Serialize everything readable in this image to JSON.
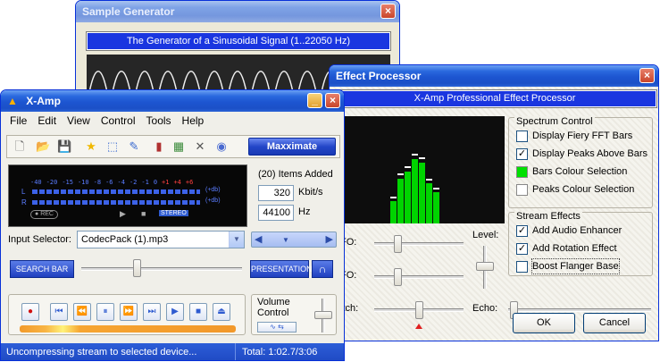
{
  "generator": {
    "title": "Sample Generator",
    "banner": "The Generator of a Sinusoidal Signal (1..22050 Hz)"
  },
  "fx": {
    "title": "Effect Processor",
    "banner": "X-Amp Professional Effect Processor",
    "spectrum_group": "Spectrum Control",
    "spectrum_options": [
      {
        "label": "Display Fiery FFT Bars",
        "checked": "false"
      },
      {
        "label": "Display Peaks Above Bars",
        "checked": "true"
      },
      {
        "label": "Bars Colour Selection",
        "swatch": "#00e000"
      },
      {
        "label": "Peaks Colour Selection",
        "swatch": "#ffffff"
      }
    ],
    "stream_group": "Stream Effects",
    "stream_options": [
      {
        "label": "Add Audio Enhancer",
        "checked": "true"
      },
      {
        "label": "Add Rotation Effect",
        "checked": "true"
      },
      {
        "label": "Boost Flanger Base",
        "checked": "false"
      }
    ],
    "labels": {
      "fo1": "FO:",
      "fo2": "FO:",
      "level": "Level:",
      "pitch": "itch:",
      "echo": "Echo:"
    },
    "ok": "OK",
    "cancel": "Cancel"
  },
  "xamp": {
    "title": "X-Amp",
    "menu": [
      "File",
      "Edit",
      "View",
      "Control",
      "Tools",
      "Help"
    ],
    "maximate": "Maxximate",
    "meter_scale": [
      "-40",
      "-20",
      "-15",
      "-10",
      "-8",
      "-6",
      "-4",
      "-2",
      "-1",
      "0",
      "+1",
      "+4",
      "+6"
    ],
    "db_label": "(+db)",
    "channel_l": "L",
    "channel_r": "R",
    "rec": "REC",
    "stereo": "STEREO",
    "items_added": "(20) Items Added",
    "bitrate_value": "320",
    "bitrate_unit": "Kbit/s",
    "freq_value": "44100",
    "freq_unit": "Hz",
    "input_label": "Input Selector:",
    "input_value": "CodecPack (1).mp3",
    "search_bar": "SEARCH BAR",
    "presentation": "PRESENTATION",
    "volume_label": "Volume\nControl",
    "status_left": "Uncompressing stream to selected device...",
    "status_right": "Total:  1:02.7/3:06",
    "progress": 0.33
  },
  "colors": {
    "accent": "#1a36e0",
    "bars": "#00e000",
    "progress": "#f2982a"
  }
}
